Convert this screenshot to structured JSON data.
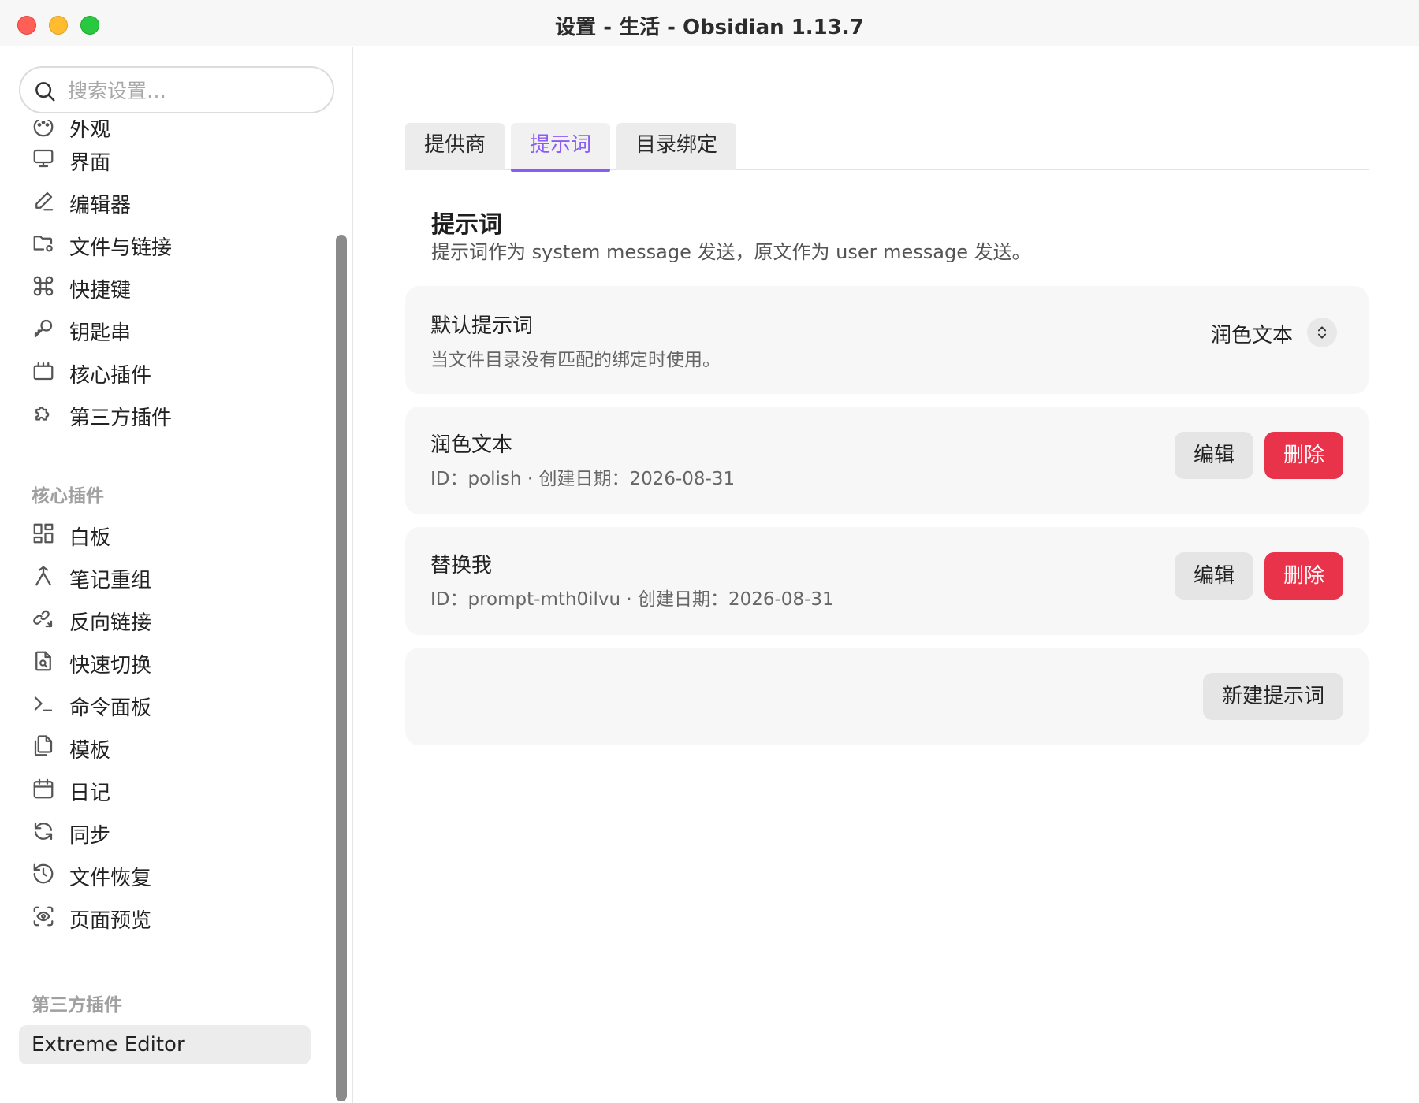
{
  "window": {
    "title": "设置 - 生活 - Obsidian 1.13.7"
  },
  "sidebar": {
    "search": {
      "placeholder": "搜索设置…",
      "value": ""
    },
    "items": [
      {
        "label": "外观",
        "icon": "palette-icon"
      },
      {
        "label": "界面",
        "icon": "monitor-icon"
      },
      {
        "label": "编辑器",
        "icon": "pencil-icon"
      },
      {
        "label": "文件与链接",
        "icon": "folder-cog-icon"
      },
      {
        "label": "快捷键",
        "icon": "command-icon"
      },
      {
        "label": "钥匙串",
        "icon": "key-icon"
      },
      {
        "label": "核心插件",
        "icon": "box-icon"
      },
      {
        "label": "第三方插件",
        "icon": "puzzle-icon"
      }
    ],
    "core_plugins_header": "核心插件",
    "core_plugins": [
      {
        "label": "白板",
        "icon": "layout-dashboard-icon"
      },
      {
        "label": "笔记重组",
        "icon": "merge-icon"
      },
      {
        "label": "反向链接",
        "icon": "backlink-icon"
      },
      {
        "label": "快速切换",
        "icon": "file-search-icon"
      },
      {
        "label": "命令面板",
        "icon": "terminal-icon"
      },
      {
        "label": "模板",
        "icon": "files-icon"
      },
      {
        "label": "日记",
        "icon": "calendar-icon"
      },
      {
        "label": "同步",
        "icon": "refresh-icon"
      },
      {
        "label": "文件恢复",
        "icon": "history-icon"
      },
      {
        "label": "页面预览",
        "icon": "scan-eye-icon"
      }
    ],
    "third_party_header": "第三方插件",
    "third_party": [
      {
        "label": "Extreme Editor",
        "selected": true
      }
    ]
  },
  "main": {
    "tabs": [
      {
        "label": "提供商",
        "active": false
      },
      {
        "label": "提示词",
        "active": true
      },
      {
        "label": "目录绑定",
        "active": false
      }
    ],
    "section": {
      "title": "提示词",
      "description": "提示词作为 system message 发送，原文作为 user message 发送。"
    },
    "default_prompt": {
      "title": "默认提示词",
      "description": "当文件目录没有匹配的绑定时使用。",
      "selected_value": "润色文本"
    },
    "prompts": [
      {
        "title": "润色文本",
        "meta": "ID：polish · 创建日期：2026-08-31",
        "edit_label": "编辑",
        "delete_label": "删除"
      },
      {
        "title": "替换我",
        "meta": "ID：prompt-mth0ilvu · 创建日期：2026-08-31",
        "edit_label": "编辑",
        "delete_label": "删除"
      }
    ],
    "new_prompt_label": "新建提示词"
  },
  "colors": {
    "accent": "#8a5cf5",
    "danger": "#e8334a",
    "close": "#ff5f57",
    "minimize": "#febc2e",
    "maximize": "#28c840"
  }
}
